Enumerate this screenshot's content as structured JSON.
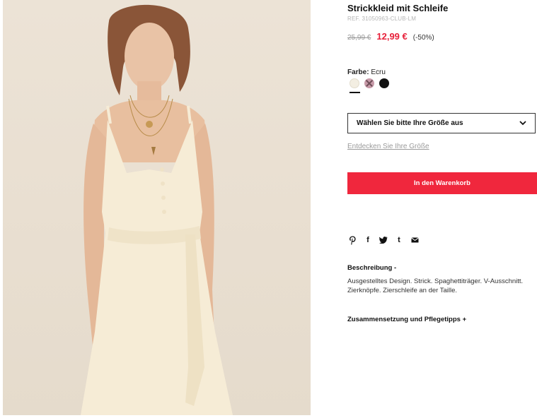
{
  "product": {
    "title": "Strickkleid mit Schleife",
    "ref": "REF. 31050963-CLUB-LM",
    "old_price": "25,99 €",
    "new_price": "12,99 €",
    "discount": "(-50%)"
  },
  "color": {
    "label": "Farbe:",
    "value": "Ecru",
    "swatches": [
      {
        "name": "ecru",
        "color": "#f3eee2",
        "selected": true
      },
      {
        "name": "pink",
        "color": "#c79aa8",
        "available": false
      },
      {
        "name": "black",
        "color": "#111111"
      }
    ]
  },
  "size": {
    "placeholder": "Wählen Sie bitte Ihre Größe aus",
    "guide_link": "Entdecken Sie Ihre Größe"
  },
  "cart": {
    "button_label": "In den Warenkorb",
    "color": "#f0273d"
  },
  "share": {
    "icons": [
      {
        "name": "pinterest-icon",
        "glyph": "P"
      },
      {
        "name": "facebook-icon",
        "glyph": "f"
      },
      {
        "name": "twitter-icon",
        "glyph": "t"
      },
      {
        "name": "tumblr-icon",
        "glyph": "t"
      },
      {
        "name": "mail-icon",
        "glyph": "✉"
      }
    ]
  },
  "description": {
    "heading": "Beschreibung -",
    "text": "Ausgestelltes Design. Strick. Spaghettiträger. V-Ausschnitt. Zierknöpfe. Zierschleife an der Taille."
  },
  "composition": {
    "heading": "Zusammensetzung und Pflegetipps +"
  }
}
